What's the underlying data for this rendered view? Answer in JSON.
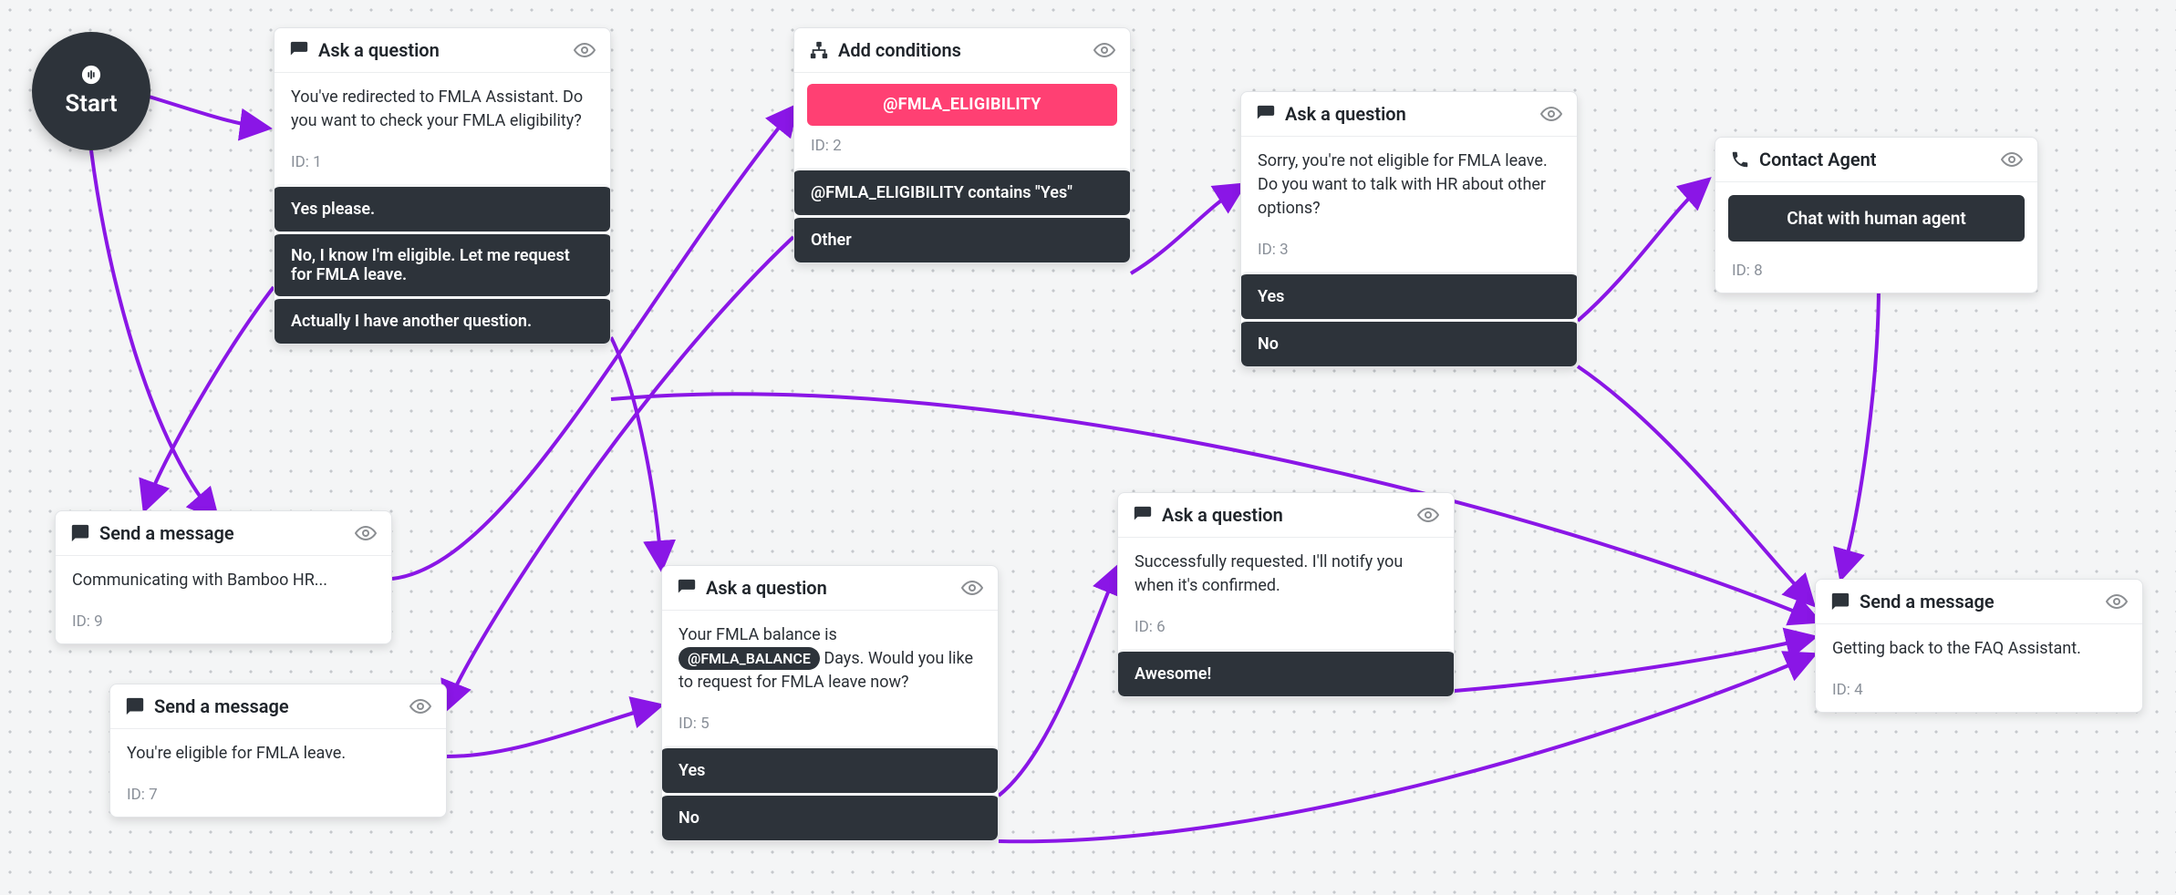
{
  "start": {
    "label": "Start"
  },
  "nodes": {
    "n1": {
      "type": "Ask a question",
      "body": "You've redirected to FMLA Assistant. Do you want to check your FMLA eligibility?",
      "id_label": "ID: 1",
      "options": [
        "Yes please.",
        "No, I know I'm eligible. Let me request for FMLA leave.",
        "Actually I have another question."
      ]
    },
    "n2": {
      "type": "Add conditions",
      "pill": "@FMLA_ELIGIBILITY",
      "id_label": "ID: 2",
      "options": [
        "@FMLA_ELIGIBILITY contains \"Yes\"",
        "Other"
      ]
    },
    "n3": {
      "type": "Ask a question",
      "body": "Sorry, you're not eligible for FMLA leave. Do you want to talk with HR about other options?",
      "id_label": "ID: 3",
      "options": [
        "Yes",
        "No"
      ]
    },
    "n5": {
      "type": "Ask a question",
      "body_pre": "Your FMLA balance is ",
      "body_pill": "@FMLA_BALANCE",
      "body_post": " Days. Would you like to request for FMLA leave now?",
      "id_label": "ID: 5",
      "options": [
        "Yes",
        "No"
      ]
    },
    "n6": {
      "type": "Ask a question",
      "body": "Successfully requested. I'll notify you when it's confirmed.",
      "id_label": "ID: 6",
      "options": [
        "Awesome!"
      ]
    },
    "n7": {
      "type": "Send a message",
      "body": "You're eligible for FMLA leave.",
      "id_label": "ID: 7"
    },
    "n8": {
      "type": "Contact Agent",
      "button": "Chat with human agent",
      "id_label": "ID: 8"
    },
    "n9": {
      "type": "Send a message",
      "body": "Communicating with Bamboo HR...",
      "id_label": "ID: 9"
    },
    "n4": {
      "type": "Send a message",
      "body": "Getting back to the FAQ Assistant.",
      "id_label": "ID: 4"
    }
  }
}
